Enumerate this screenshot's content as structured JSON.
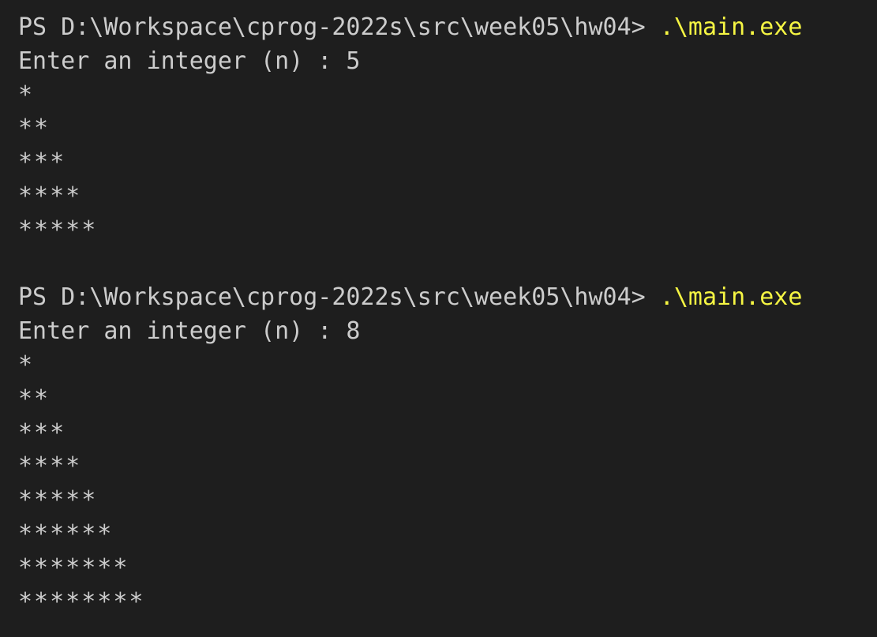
{
  "terminal": {
    "colors": {
      "background": "#1e1e1e",
      "text": "#cccccc",
      "command": "#f5f543"
    },
    "runs": [
      {
        "prompt": "PS D:\\Workspace\\cprog-2022s\\src\\week05\\hw04> ",
        "command": ".\\main.exe",
        "input_line": "Enter an integer (n) : 5",
        "output": [
          "*",
          "**",
          "***",
          "****",
          "*****"
        ]
      },
      {
        "prompt": "PS D:\\Workspace\\cprog-2022s\\src\\week05\\hw04> ",
        "command": ".\\main.exe",
        "input_line": "Enter an integer (n) : 8",
        "output": [
          "*",
          "**",
          "***",
          "****",
          "*****",
          "******",
          "*******",
          "********"
        ]
      }
    ]
  }
}
